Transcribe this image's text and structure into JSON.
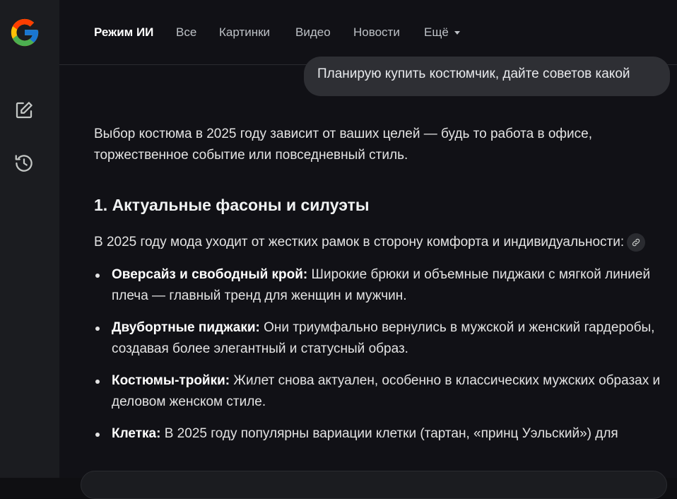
{
  "sidebar": {
    "logo_icon": "google-g-logo",
    "buttons": [
      {
        "icon": "new-chat-edit-icon"
      },
      {
        "icon": "history-icon"
      }
    ]
  },
  "nav": {
    "tabs": [
      {
        "label": "Режим ИИ",
        "active": true
      },
      {
        "label": "Все"
      },
      {
        "label": "Картинки"
      },
      {
        "label": "Видео"
      },
      {
        "label": "Новости"
      },
      {
        "label": "Ещё"
      }
    ]
  },
  "user_query": "Планирую купить костюмчик, дайте советов какой",
  "answer": {
    "intro": "Выбор костюма в 2025 году зависит от ваших целей — будь то работа в офисе, торжественное событие или повседневный стиль.",
    "section_title": "1. Актуальные фасоны и силуэты",
    "section_intro": "В 2025 году мода уходит от жестких рамок в сторону комфорта и индивидуальности:",
    "bullets": [
      {
        "title": "Оверсайз и свободный крой:",
        "text": " Широкие брюки и объемные пиджаки с мягкой линией плеча — главный тренд для женщин и мужчин."
      },
      {
        "title": "Двубортные пиджаки:",
        "text": " Они триумфально вернулись в мужской и женский гардеробы, создавая более элегантный и статусный образ."
      },
      {
        "title": "Костюмы-тройки:",
        "text": " Жилет снова актуален, особенно в классических мужских образах и деловом женском стиле."
      },
      {
        "title": "Клетка:",
        "text": " В 2025 году популярны вариации клетки (тартан, «принц Уэльский») для"
      }
    ]
  },
  "colors": {
    "sidebar_bg": "#1b1c20",
    "main_bg": "#111116",
    "bubble_bg": "#2e2f34",
    "text": "#e3e3e3"
  }
}
